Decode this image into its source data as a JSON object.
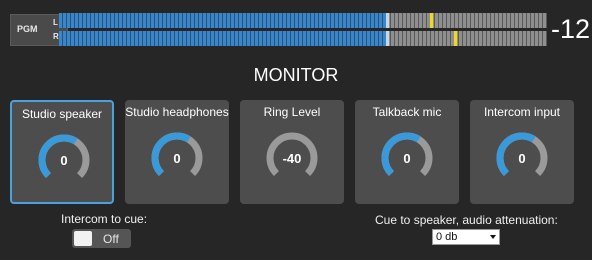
{
  "meter": {
    "label": "PGM",
    "channels": [
      {
        "name": "L",
        "level_fraction": 0.67,
        "marker_fraction": 0.67,
        "peak_fraction": 0.76
      },
      {
        "name": "R",
        "level_fraction": 0.67,
        "marker_fraction": 0.67,
        "peak_fraction": 0.81
      }
    ],
    "readout": "-12",
    "colors": {
      "active": "#3a86c8",
      "inactive": "#8f8f8f",
      "peak": "#f0d91a"
    }
  },
  "title": "MONITOR",
  "knobs": [
    {
      "label": "Studio speaker",
      "value": "0",
      "level": 0.62,
      "selected": true
    },
    {
      "label": "Studio headphones",
      "value": "0",
      "level": 0.62,
      "selected": false
    },
    {
      "label": "Ring Level",
      "value": "-40",
      "level": 0.0,
      "selected": false
    },
    {
      "label": "Talkback mic",
      "value": "0",
      "level": 0.62,
      "selected": false
    },
    {
      "label": "Intercom input",
      "value": "0",
      "level": 0.62,
      "selected": false
    }
  ],
  "colors": {
    "accent": "#3a9ad9",
    "track": "#9a9a9a",
    "tile": "#4d4d4d",
    "background": "#262626"
  },
  "intercom_to_cue": {
    "label": "Intercom to cue:",
    "state": "Off"
  },
  "cue_attenuation": {
    "label": "Cue to speaker, audio attenuation:",
    "selected": "0 db"
  }
}
